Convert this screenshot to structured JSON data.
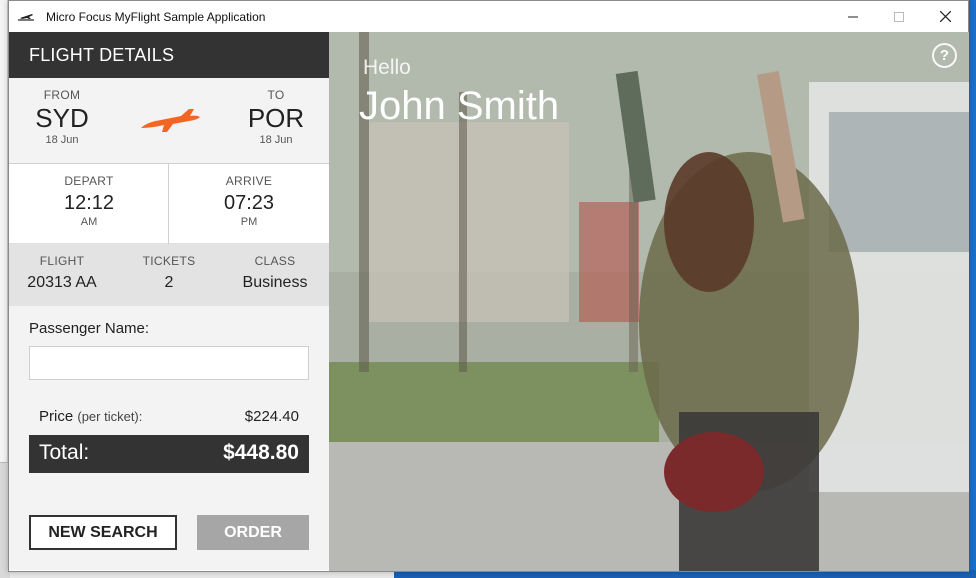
{
  "window": {
    "title": "Micro Focus MyFlight Sample Application"
  },
  "panel": {
    "header": "FLIGHT DETAILS",
    "route": {
      "from_label": "FROM",
      "from_code": "SYD",
      "from_date": "18 Jun",
      "to_label": "TO",
      "to_code": "POR",
      "to_date": "18 Jun"
    },
    "times": {
      "depart_label": "DEPART",
      "depart_time": "12:12",
      "depart_ampm": "AM",
      "arrive_label": "ARRIVE",
      "arrive_time": "07:23",
      "arrive_ampm": "PM"
    },
    "info": {
      "flight_label": "FLIGHT",
      "flight_value": "20313 AA",
      "tickets_label": "TICKETS",
      "tickets_value": "2",
      "class_label": "CLASS",
      "class_value": "Business"
    },
    "passenger": {
      "label": "Passenger Name:",
      "value": ""
    },
    "pricing": {
      "price_label": "Price",
      "price_sub": "(per ticket):",
      "price_value": "$224.40",
      "total_label": "Total:",
      "total_value": "$448.80"
    },
    "buttons": {
      "new_search": "NEW SEARCH",
      "order": "ORDER"
    }
  },
  "hero": {
    "greeting": "Hello",
    "user_name": "John Smith",
    "help_glyph": "?"
  },
  "icons": {
    "app": "airplane-icon",
    "plane": "airplane-icon",
    "minimize": "minimize-icon",
    "maximize": "maximize-icon",
    "close": "close-icon",
    "help": "help-icon"
  },
  "colors": {
    "accent": "#f26522",
    "header_bg": "#333333",
    "order_disabled": "#a6a6a6"
  }
}
